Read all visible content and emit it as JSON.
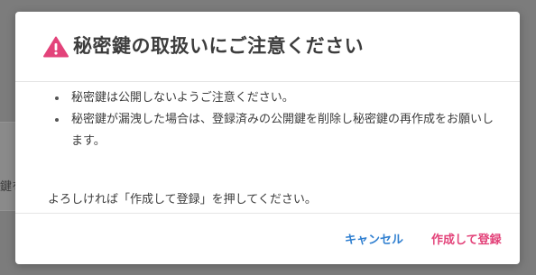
{
  "background": {
    "partial_text": "鍵を"
  },
  "dialog": {
    "title": "秘密鍵の取扱いにご注意ください",
    "warning_icon": "warning-triangle-icon",
    "notices": [
      "秘密鍵は公開しないようご注意ください。",
      "秘密鍵が漏洩した場合は、登録済みの公開鍵を削除し秘密鍵の再作成をお願いします。"
    ],
    "confirm_text": "よろしければ「作成して登録」を押してください。",
    "cancel_label": "キャンセル",
    "confirm_label": "作成して登録"
  },
  "colors": {
    "title": "#3d3d3d",
    "warning_icon": "#e3437a",
    "cancel": "#2f7fd0",
    "confirm": "#e3437a",
    "overlay": "#7c7c7c"
  }
}
